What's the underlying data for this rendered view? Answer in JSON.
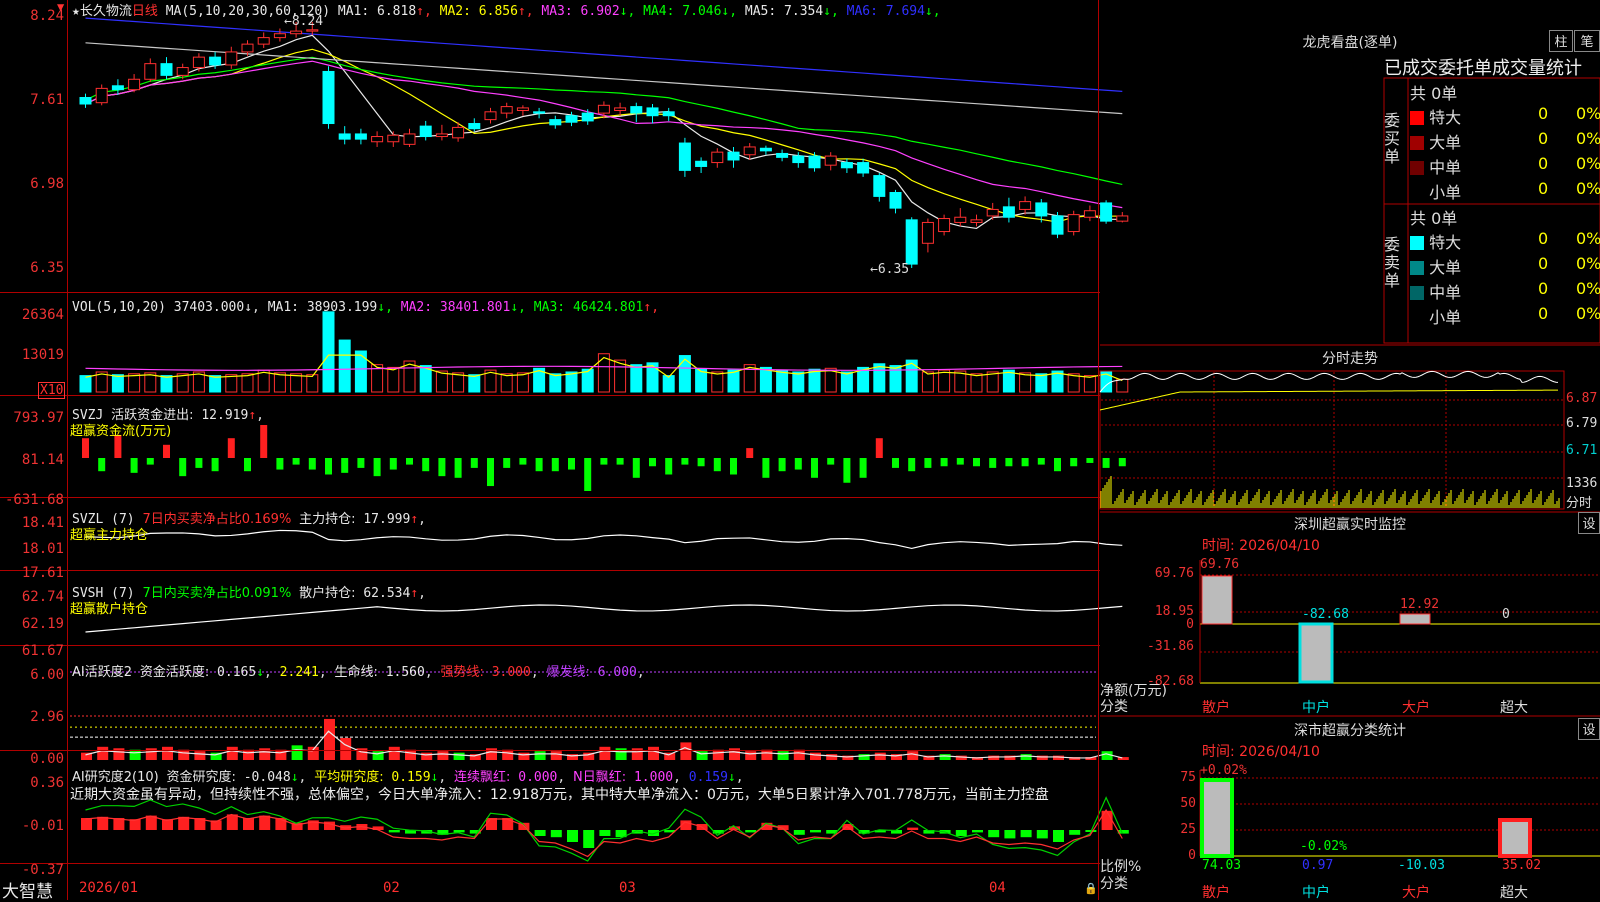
{
  "stock": {
    "name": "长久物流",
    "period": "日线",
    "ma_header": "MA(5,10,20,30,60,120)",
    "ma_values": [
      {
        "label": "MA1:",
        "value": "6.818",
        "arrow": "↑",
        "color": "#e8e8e8"
      },
      {
        "label": "MA2:",
        "value": "6.856",
        "arrow": "↑",
        "color": "#ffff00"
      },
      {
        "label": "MA3:",
        "value": "6.902",
        "arrow": "↓",
        "color": "#ff40ff"
      },
      {
        "label": "MA4:",
        "value": "7.046",
        "arrow": "↓",
        "color": "#00ff00"
      },
      {
        "label": "MA5:",
        "value": "7.354",
        "arrow": "↓",
        "color": "#e8e8e8"
      },
      {
        "label": "MA6:",
        "value": "7.694",
        "arrow": "↓",
        "color": "#3030ff"
      }
    ],
    "price_axis": [
      "8.24",
      "7.61",
      "6.98",
      "6.35"
    ],
    "high_marker": "8.24",
    "low_marker": "6.35"
  },
  "vol": {
    "header": "VOL(5,10,20)",
    "value": "37403.000",
    "ma": [
      {
        "label": "MA1:",
        "value": "38903.199",
        "arrow": "↓",
        "color": "#e8e8e8"
      },
      {
        "label": "MA2:",
        "value": "38401.801",
        "arrow": "↓",
        "color": "#ff40ff"
      },
      {
        "label": "MA3:",
        "value": "46424.801",
        "arrow": "↑",
        "color": "#00ff00"
      }
    ],
    "axis": [
      "26364",
      "13019"
    ],
    "unit": "X10"
  },
  "svzj": {
    "header": "SVZJ",
    "label": "活跃资金进出:",
    "value": "12.919",
    "arrow": "↑",
    "subtitle": "超赢资金流(万元)",
    "axis": [
      "793.97",
      "81.14",
      "-631.68"
    ]
  },
  "svzl": {
    "header": "SVZL (7)",
    "desc": "7日内买卖净占比0.169%",
    "label": "主力持仓:",
    "value": "17.999",
    "arrow": "↑",
    "subtitle": "超赢主力持仓",
    "axis": [
      "18.41",
      "18.01",
      "17.61"
    ]
  },
  "svsh": {
    "header": "SVSH (7)",
    "desc": "7日内买卖净占比0.091%",
    "label": "散户持仓:",
    "value": "62.534",
    "arrow": "↑",
    "subtitle": "超赢散户持仓",
    "axis": [
      "62.74",
      "62.19",
      "61.67"
    ]
  },
  "ai1": {
    "header": "AI活跃度2",
    "label": "资金活跃度:",
    "value": "0.165",
    "arrow": "↓",
    "value2": "2.241",
    "life_label": "生命线:",
    "life": "1.560",
    "strong_label": "强势线:",
    "strong": "3.000",
    "burst_label": "爆发线:",
    "burst": "6.000",
    "axis": [
      "6.00",
      "2.96",
      "0.00"
    ]
  },
  "ai2": {
    "header": "AI研究度2(10)",
    "label": "资金研究度:",
    "value": "-0.048",
    "arrow": "↓",
    "avg_label": "平均研究度:",
    "avg": "0.159",
    "cont_label": "连续飘红:",
    "cont": "0.000",
    "n_label": "N日飘红:",
    "n": "1.000",
    "last": "0.159",
    "comment": "近期大资金虽有异动，但持续性不强，总体偏空，今日大单净流入：12.918万元，其中特大单净流入：0万元，大单5日累计净入701.778万元，当前主力控盘",
    "axis": [
      "0.36",
      "-0.01",
      "-0.37"
    ]
  },
  "dates": [
    "2026/01",
    "02",
    "03",
    "04"
  ],
  "brand": "大智慧",
  "right": {
    "title": "龙虎看盘(逐单)",
    "btn1": "柱",
    "btn2": "笔",
    "tabs": "已成交委托单成交量统计",
    "buy_label": "委买单",
    "sell_label": "委卖单",
    "buy_total": "共 0单",
    "sell_total": "共 0单",
    "buy_rows": [
      {
        "name": "特大",
        "count": "0",
        "pct": "0%",
        "color": "#ff0000"
      },
      {
        "name": "大单",
        "count": "0",
        "pct": "0%",
        "color": "#a00000"
      },
      {
        "name": "中单",
        "count": "0",
        "pct": "0%",
        "color": "#700000"
      },
      {
        "name": "小单",
        "count": "0",
        "pct": "0%",
        "color": "#000000"
      }
    ],
    "sell_rows": [
      {
        "name": "特大",
        "count": "0",
        "pct": "0%",
        "color": "#00ffff"
      },
      {
        "name": "大单",
        "count": "0",
        "pct": "0%",
        "color": "#008888"
      },
      {
        "name": "中单",
        "count": "0",
        "pct": "0%",
        "color": "#006666"
      },
      {
        "name": "小单",
        "count": "0",
        "pct": "0%",
        "color": "#000000"
      }
    ],
    "intraday_title": "分时走势",
    "intraday_axis": [
      "6.87",
      "6.79",
      "6.71"
    ],
    "intraday_vol": "1336",
    "intraday_unit": "分时",
    "monitor_title": "深圳超赢实时监控",
    "monitor_btn": "设",
    "monitor_time": "时间: 2026/04/10",
    "monitor_axis": [
      "69.76",
      "18.95",
      "0",
      "-31.86",
      "-82.68"
    ],
    "monitor_ylabel": "净额(万元)",
    "monitor_xlabel": "分类",
    "monitor_vals": [
      "69.76",
      "-82.68",
      "12.92",
      "0"
    ],
    "monitor_cats": [
      "散户",
      "中户",
      "大户",
      "超大"
    ],
    "class_title": "深市超赢分类统计",
    "class_btn": "设",
    "class_time": "时间: 2026/04/10",
    "class_axis": [
      "75",
      "50",
      "25",
      "0"
    ],
    "class_ylabel": "比例%",
    "class_xlabel": "分类",
    "class_top": [
      "+0.02%",
      "-0.02%"
    ],
    "class_vals": [
      "74.03",
      "0.97",
      "-10.03",
      "35.02"
    ],
    "class_cats": [
      "散户",
      "中户",
      "大户",
      "超大"
    ]
  },
  "chart_data": {
    "type": "candlestick",
    "candles": [
      [
        7.66,
        7.61,
        7.69,
        7.58
      ],
      [
        7.62,
        7.73,
        7.76,
        7.6
      ],
      [
        7.75,
        7.72,
        7.8,
        7.68
      ],
      [
        7.72,
        7.8,
        7.84,
        7.7
      ],
      [
        7.8,
        7.92,
        7.96,
        7.78
      ],
      [
        7.92,
        7.83,
        7.97,
        7.8
      ],
      [
        7.83,
        7.89,
        7.92,
        7.8
      ],
      [
        7.89,
        7.97,
        8.0,
        7.86
      ],
      [
        7.97,
        7.91,
        8.01,
        7.88
      ],
      [
        7.91,
        8.01,
        8.05,
        7.88
      ],
      [
        8.01,
        8.07,
        8.1,
        7.98
      ],
      [
        8.07,
        8.12,
        8.16,
        8.04
      ],
      [
        8.12,
        8.15,
        8.19,
        8.09
      ],
      [
        8.15,
        8.17,
        8.24,
        8.12
      ],
      [
        8.17,
        8.18,
        8.24,
        8.14
      ],
      [
        7.86,
        7.46,
        7.9,
        7.42
      ],
      [
        7.38,
        7.34,
        7.44,
        7.3
      ],
      [
        7.38,
        7.34,
        7.42,
        7.3
      ],
      [
        7.32,
        7.36,
        7.4,
        7.28
      ],
      [
        7.32,
        7.37,
        7.4,
        7.28
      ],
      [
        7.3,
        7.38,
        7.42,
        7.28
      ],
      [
        7.44,
        7.36,
        7.48,
        7.33
      ],
      [
        7.36,
        7.38,
        7.45,
        7.33
      ],
      [
        7.35,
        7.43,
        7.47,
        7.32
      ],
      [
        7.46,
        7.42,
        7.5,
        7.4
      ],
      [
        7.49,
        7.55,
        7.58,
        7.46
      ],
      [
        7.54,
        7.59,
        7.62,
        7.5
      ],
      [
        7.56,
        7.58,
        7.6,
        7.52
      ],
      [
        7.55,
        7.54,
        7.58,
        7.5
      ],
      [
        7.49,
        7.45,
        7.52,
        7.42
      ],
      [
        7.52,
        7.47,
        7.55,
        7.44
      ],
      [
        7.54,
        7.48,
        7.57,
        7.45
      ],
      [
        7.54,
        7.6,
        7.63,
        7.5
      ],
      [
        7.56,
        7.58,
        7.62,
        7.52
      ],
      [
        7.59,
        7.54,
        7.62,
        7.47
      ],
      [
        7.58,
        7.52,
        7.61,
        7.46
      ],
      [
        7.55,
        7.52,
        7.58,
        7.48
      ],
      [
        7.31,
        7.1,
        7.35,
        7.05
      ],
      [
        7.17,
        7.13,
        7.2,
        7.08
      ],
      [
        7.16,
        7.24,
        7.27,
        7.12
      ],
      [
        7.24,
        7.18,
        7.28,
        7.12
      ],
      [
        7.22,
        7.28,
        7.31,
        7.18
      ],
      [
        7.27,
        7.25,
        7.29,
        7.22
      ],
      [
        7.23,
        7.2,
        7.26,
        7.17
      ],
      [
        7.21,
        7.16,
        7.24,
        7.12
      ],
      [
        7.21,
        7.12,
        7.24,
        7.09
      ],
      [
        7.14,
        7.21,
        7.24,
        7.1
      ],
      [
        7.16,
        7.12,
        7.19,
        7.08
      ],
      [
        7.16,
        7.08,
        7.19,
        7.05
      ],
      [
        7.06,
        6.9,
        7.08,
        6.86
      ],
      [
        6.93,
        6.81,
        6.95,
        6.77
      ],
      [
        6.72,
        6.38,
        6.74,
        6.35
      ],
      [
        6.54,
        6.7,
        6.73,
        6.47
      ],
      [
        6.63,
        6.73,
        6.76,
        6.6
      ],
      [
        6.7,
        6.74,
        6.81,
        6.67
      ],
      [
        6.7,
        6.72,
        6.76,
        6.67
      ],
      [
        6.75,
        6.8,
        6.85,
        6.72
      ],
      [
        6.82,
        6.74,
        6.89,
        6.7
      ],
      [
        6.8,
        6.86,
        6.9,
        6.76
      ],
      [
        6.85,
        6.75,
        6.88,
        6.7
      ],
      [
        6.75,
        6.61,
        6.78,
        6.58
      ],
      [
        6.63,
        6.76,
        6.79,
        6.6
      ],
      [
        6.74,
        6.79,
        6.83,
        6.71
      ],
      [
        6.85,
        6.71,
        6.87,
        6.69
      ],
      [
        6.71,
        6.75,
        6.78,
        6.7
      ]
    ],
    "vol": [
      18,
      22,
      19,
      20,
      21,
      18,
      20,
      22,
      18,
      19,
      20,
      24,
      21,
      20,
      19,
      88,
      57,
      45,
      30,
      27,
      34,
      29,
      23,
      21,
      19,
      24,
      20,
      21,
      26,
      20,
      22,
      25,
      42,
      35,
      30,
      32,
      18,
      40,
      25,
      22,
      24,
      30,
      27,
      24,
      22,
      25,
      26,
      22,
      27,
      31,
      29,
      35,
      22,
      24,
      23,
      20,
      22,
      24,
      21,
      20,
      23,
      20,
      18,
      22,
      14
    ],
    "svzj": [
      60,
      -40,
      70,
      -45,
      -20,
      40,
      -55,
      -30,
      -40,
      60,
      -40,
      100,
      -35,
      -20,
      -35,
      -50,
      -45,
      -30,
      -55,
      -35,
      -20,
      -40,
      -55,
      -60,
      -30,
      -85,
      -30,
      -20,
      -40,
      -40,
      -35,
      -100,
      -20,
      -20,
      -60,
      -25,
      -50,
      -20,
      -25,
      -40,
      -50,
      30,
      -60,
      -40,
      -35,
      -60,
      -20,
      -75,
      -60,
      60,
      -30,
      -40,
      -30,
      -25,
      -20,
      -25,
      -30,
      -25,
      -25,
      -20,
      -40,
      -25,
      -15,
      -30,
      -25
    ],
    "ai1": [
      0.5,
      0.9,
      0.8,
      0.7,
      0.8,
      0.9,
      0.7,
      0.6,
      0.5,
      0.9,
      0.7,
      0.8,
      0.7,
      1.0,
      0.9,
      2.8,
      1.5,
      0.8,
      0.6,
      0.9,
      0.7,
      0.5,
      0.6,
      0.5,
      0.4,
      0.8,
      0.7,
      0.5,
      0.6,
      0.6,
      0.4,
      0.5,
      0.9,
      0.8,
      0.8,
      0.9,
      0.5,
      1.2,
      0.6,
      0.7,
      0.8,
      0.6,
      0.7,
      0.6,
      0.7,
      0.5,
      0.4,
      0.3,
      0.4,
      0.5,
      0.4,
      0.6,
      0.3,
      0.4,
      0.3,
      0.2,
      0.3,
      0.3,
      0.4,
      0.3,
      0.3,
      0.2,
      0.2,
      0.6,
      0.2
    ],
    "ai2": [
      0.1,
      0.11,
      0.1,
      0.09,
      0.12,
      0.09,
      0.11,
      0.1,
      0.08,
      0.13,
      0.1,
      0.12,
      0.1,
      0.06,
      0.08,
      0.07,
      0.04,
      0.05,
      0.03,
      -0.02,
      -0.03,
      -0.03,
      -0.04,
      -0.02,
      -0.03,
      0.1,
      0.1,
      0.06,
      -0.05,
      -0.06,
      -0.1,
      -0.15,
      -0.05,
      -0.06,
      -0.03,
      -0.05,
      -0.02,
      0.08,
      0.05,
      -0.03,
      0.03,
      -0.02,
      0.06,
      0.04,
      -0.04,
      -0.02,
      -0.03,
      0.05,
      -0.03,
      -0.02,
      -0.03,
      0.02,
      -0.03,
      -0.03,
      -0.05,
      -0.02,
      -0.06,
      -0.07,
      -0.06,
      -0.07,
      -0.1,
      -0.04,
      -0.01,
      0.16,
      -0.03
    ]
  }
}
